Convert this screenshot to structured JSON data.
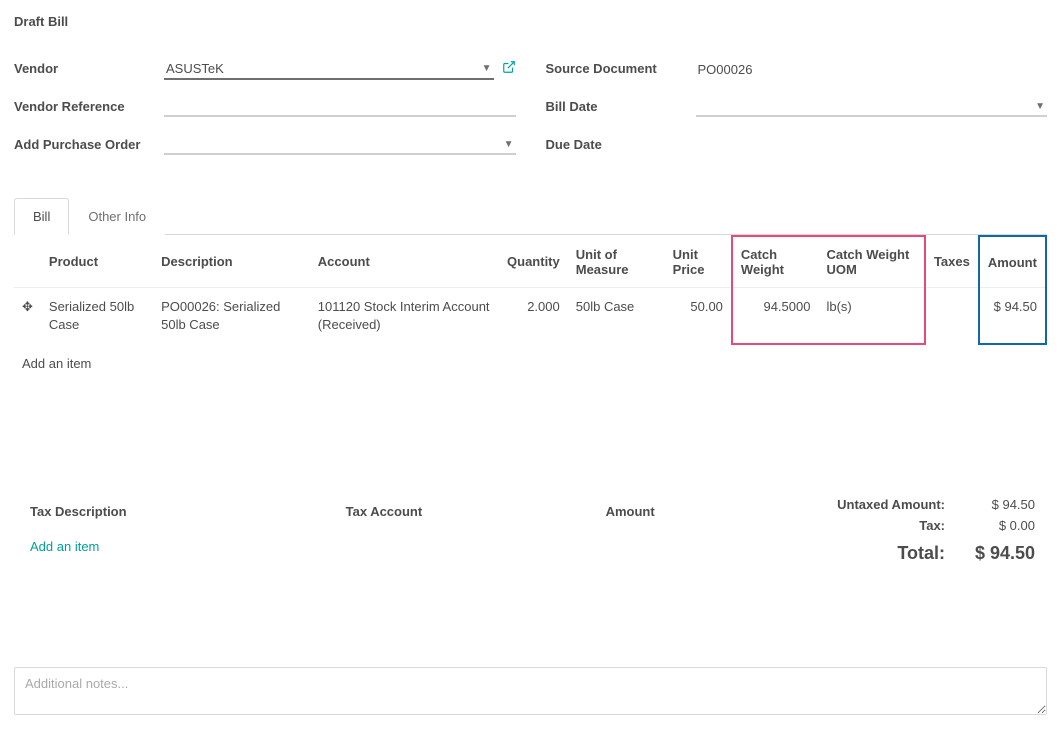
{
  "title": "Draft Bill",
  "left_fields": {
    "vendor_label": "Vendor",
    "vendor_value": "ASUSTeK",
    "vendor_ref_label": "Vendor Reference",
    "vendor_ref_value": "",
    "add_po_label": "Add Purchase Order",
    "add_po_value": ""
  },
  "right_fields": {
    "source_doc_label": "Source Document",
    "source_doc_value": "PO00026",
    "bill_date_label": "Bill Date",
    "bill_date_value": "",
    "due_date_label": "Due Date",
    "due_date_value": ""
  },
  "tabs": {
    "bill": "Bill",
    "other": "Other Info"
  },
  "columns": {
    "product": "Product",
    "description": "Description",
    "account": "Account",
    "quantity": "Quantity",
    "uom": "Unit of Measure",
    "unit_price": "Unit Price",
    "catch_weight": "Catch Weight",
    "catch_weight_uom": "Catch Weight UOM",
    "taxes": "Taxes",
    "amount": "Amount"
  },
  "line": {
    "product": "Serialized 50lb Case",
    "description": "PO00026: Serialized 50lb Case",
    "account": "101120 Stock Interim Account (Received)",
    "quantity": "2.000",
    "uom": "50lb Case",
    "unit_price": "50.00",
    "catch_weight": "94.5000",
    "catch_weight_uom": "lb(s)",
    "taxes": "",
    "amount": "$ 94.50"
  },
  "add_item": "Add an item",
  "tax_columns": {
    "desc": "Tax Description",
    "account": "Tax Account",
    "amount": "Amount"
  },
  "totals": {
    "untaxed_label": "Untaxed Amount:",
    "untaxed_value": "$ 94.50",
    "tax_label": "Tax:",
    "tax_value": "$ 0.00",
    "total_label": "Total:",
    "total_value": "$ 94.50"
  },
  "notes_placeholder": "Additional notes..."
}
